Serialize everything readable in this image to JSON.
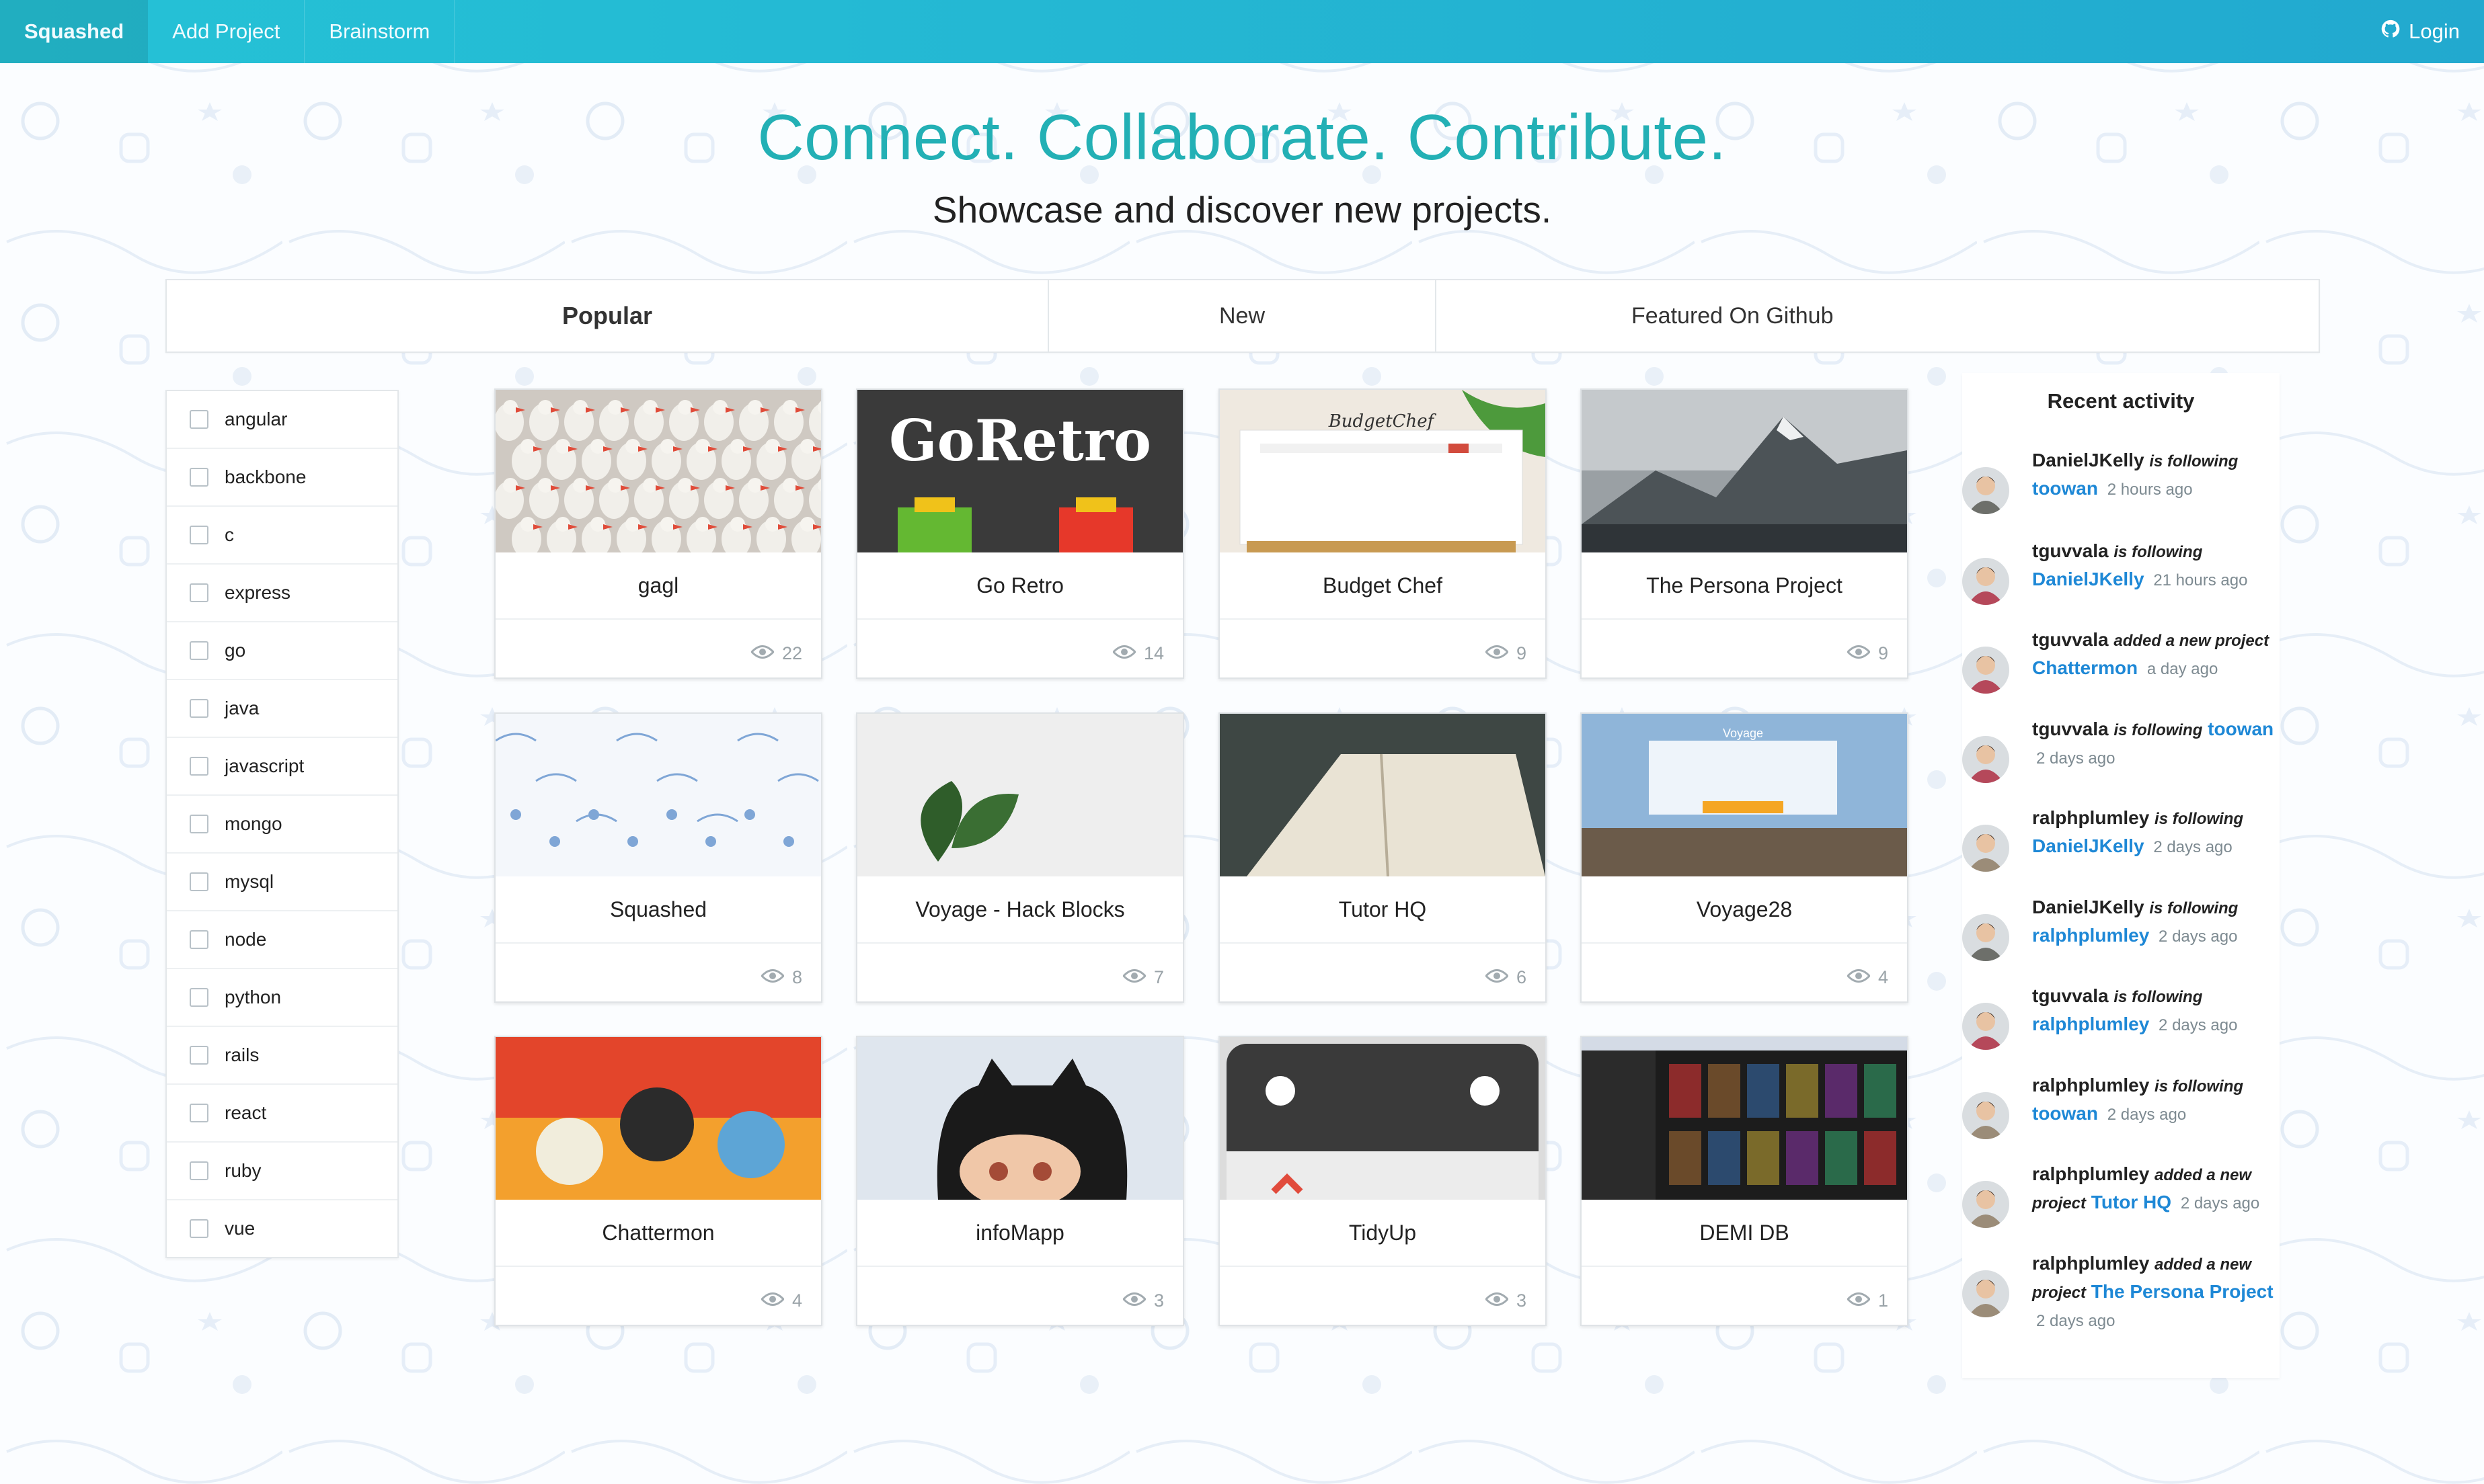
{
  "nav": {
    "brand": "Squashed",
    "items": [
      {
        "label": "Add Project"
      },
      {
        "label": "Brainstorm"
      }
    ],
    "login": "Login"
  },
  "hero": {
    "title": "Connect. Collaborate. Contribute.",
    "subtitle": "Showcase and discover new projects."
  },
  "tabs": [
    {
      "label": "Popular",
      "active": true
    },
    {
      "label": "New",
      "active": false
    },
    {
      "label": "Featured On Github",
      "active": false
    }
  ],
  "filters": [
    "angular",
    "backbone",
    "c",
    "express",
    "go",
    "java",
    "javascript",
    "mongo",
    "mysql",
    "node",
    "python",
    "rails",
    "react",
    "ruby",
    "vue"
  ],
  "projects": [
    {
      "title": "gagl",
      "views": "22",
      "thumb": "geese"
    },
    {
      "title": "Go Retro",
      "views": "14",
      "thumb": "goretro",
      "thumb_text": "GoRetro"
    },
    {
      "title": "Budget Chef",
      "views": "9",
      "thumb": "budgetchef",
      "thumb_text": "BudgetChef"
    },
    {
      "title": "The Persona Project",
      "views": "9",
      "thumb": "mountain"
    },
    {
      "title": "Squashed",
      "views": "8",
      "thumb": "pattern"
    },
    {
      "title": "Voyage - Hack Blocks",
      "views": "7",
      "thumb": "plant"
    },
    {
      "title": "Tutor HQ",
      "views": "6",
      "thumb": "book"
    },
    {
      "title": "Voyage28",
      "views": "4",
      "thumb": "city",
      "thumb_text": "Voyage"
    },
    {
      "title": "Chattermon",
      "views": "4",
      "thumb": "pokemon"
    },
    {
      "title": "infoMapp",
      "views": "3",
      "thumb": "octocat"
    },
    {
      "title": "TidyUp",
      "views": "3",
      "thumb": "calendar"
    },
    {
      "title": "DEMI DB",
      "views": "1",
      "thumb": "movies"
    }
  ],
  "activity": {
    "title": "Recent activity",
    "items": [
      {
        "user": "DanielJKelly",
        "verb": "is following",
        "target": "toowan",
        "time": "2 hours ago",
        "avatar_color": "#6d6f6a"
      },
      {
        "user": "tguvvala",
        "verb": "is following",
        "target": "DanielJKelly",
        "time": "21 hours ago",
        "avatar_color": "#b5485a"
      },
      {
        "user": "tguvvala",
        "verb": "added a new project",
        "target": "Chattermon",
        "time": "a day ago",
        "avatar_color": "#b5485a"
      },
      {
        "user": "tguvvala",
        "verb": "is following",
        "target": "toowan",
        "time": "2 days ago",
        "avatar_color": "#b5485a"
      },
      {
        "user": "ralphplumley",
        "verb": "is following",
        "target": "DanielJKelly",
        "time": "2 days ago",
        "avatar_color": "#9b8c78"
      },
      {
        "user": "DanielJKelly",
        "verb": "is following",
        "target": "ralphplumley",
        "time": "2 days ago",
        "avatar_color": "#6d6f6a"
      },
      {
        "user": "tguvvala",
        "verb": "is following",
        "target": "ralphplumley",
        "time": "2 days ago",
        "avatar_color": "#b5485a"
      },
      {
        "user": "ralphplumley",
        "verb": "is following",
        "target": "toowan",
        "time": "2 days ago",
        "avatar_color": "#9b8c78"
      },
      {
        "user": "ralphplumley",
        "verb": "added a new project",
        "target": "Tutor HQ",
        "time": "2 days ago",
        "avatar_color": "#9b8c78"
      },
      {
        "user": "ralphplumley",
        "verb": "added a new project",
        "target": "The Persona Project",
        "time": "2 days ago",
        "avatar_color": "#9b8c78"
      }
    ]
  },
  "colors": {
    "navbar": "#25c2d6",
    "hero_title": "#23b0b5",
    "link": "#1e88d6"
  }
}
